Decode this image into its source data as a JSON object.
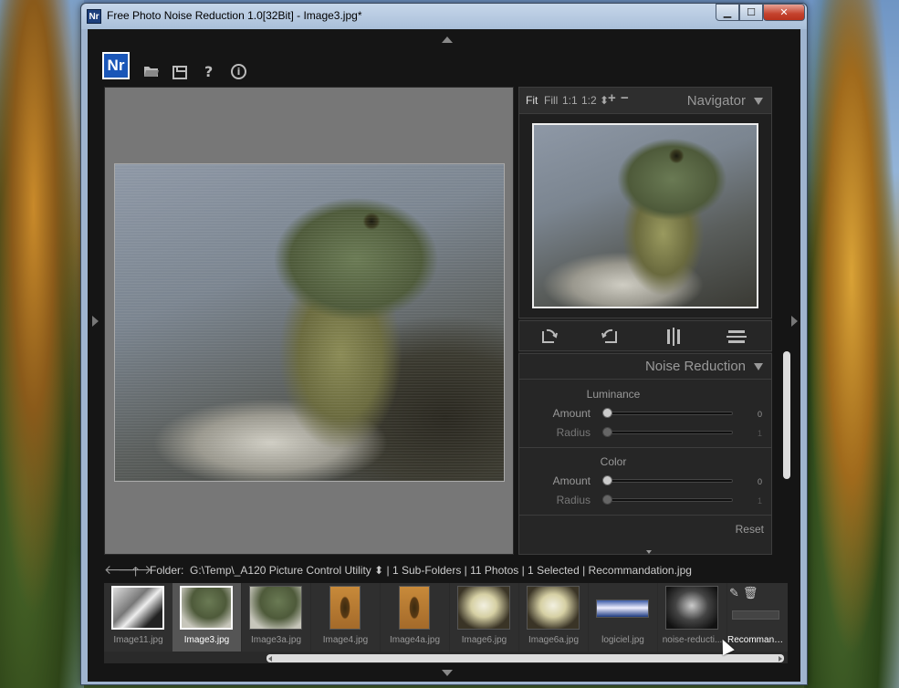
{
  "window": {
    "title": "Free Photo Noise Reduction 1.0[32Bit] - Image3.jpg*",
    "app_icon_text": "Nr",
    "controls": {
      "minimize": "▁",
      "maximize": "☐",
      "close": "✕"
    }
  },
  "toolbar": {
    "logo_text": "Nr",
    "help_label": "?",
    "info_label": "i",
    "icons": [
      "folder-open-icon",
      "save-icon",
      "help-icon",
      "info-icon"
    ]
  },
  "navigator": {
    "title": "Navigator",
    "zoom_options": [
      "Fit",
      "Fill",
      "1:1",
      "1:2 ⬍",
      "+",
      "−"
    ]
  },
  "transform": {
    "icons": [
      "rotate-left-icon",
      "rotate-right-icon",
      "flip-horizontal-icon",
      "flip-vertical-icon"
    ]
  },
  "noise_reduction": {
    "title": "Noise Reduction",
    "luminance": {
      "title": "Luminance",
      "amount_label": "Amount",
      "amount_value": "0",
      "radius_label": "Radius",
      "radius_value": "1"
    },
    "color": {
      "title": "Color",
      "amount_label": "Amount",
      "amount_value": "0",
      "radius_label": "Radius",
      "radius_value": "1"
    },
    "reset_label": "Reset"
  },
  "folder_bar": {
    "label": "Folder:",
    "path": "G:\\Temp\\_A120 Picture Control Utility ⬍",
    "info": "| 1 Sub-Folders | 11 Photos | 1 Selected | Recommandation.jpg"
  },
  "filmstrip": {
    "items": [
      {
        "name": "Image11.jpg"
      },
      {
        "name": "Image3.jpg"
      },
      {
        "name": "Image3a.jpg"
      },
      {
        "name": "Image4.jpg"
      },
      {
        "name": "Image4a.jpg"
      },
      {
        "name": "Image6.jpg"
      },
      {
        "name": "Image6a.jpg"
      },
      {
        "name": "logiciel.jpg"
      },
      {
        "name": "noise-reducti..."
      },
      {
        "name": "Recommanda..."
      }
    ],
    "selected_index": 1
  }
}
